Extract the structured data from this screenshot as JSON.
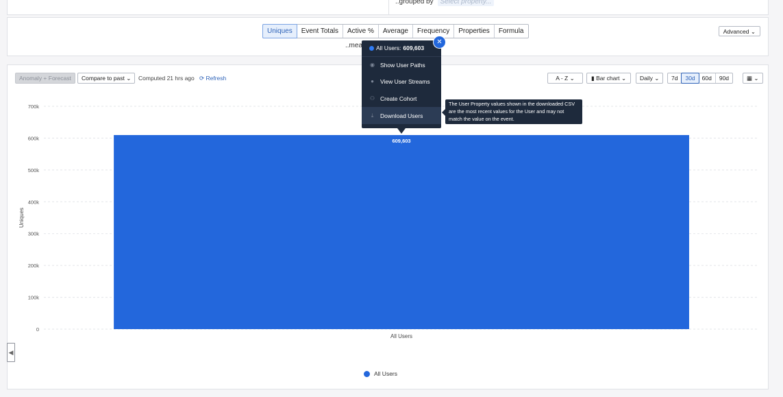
{
  "grouped_by": {
    "label": "..grouped by",
    "placeholder": "Select property..."
  },
  "measure": {
    "tabs": [
      {
        "label": "Uniques",
        "active": true
      },
      {
        "label": "Event Totals"
      },
      {
        "label": "Active %"
      },
      {
        "label": "Average"
      },
      {
        "label": "Frequency"
      },
      {
        "label": "Properties"
      },
      {
        "label": "Formula"
      }
    ],
    "label": "..mea",
    "advanced_label": "Advanced"
  },
  "toolbar": {
    "anomaly_label": "Anomaly + Forecast",
    "compare_label": "Compare to past",
    "computed_text": "Computed 21 hrs ago",
    "refresh_label": "Refresh",
    "sort_label": "A - Z",
    "chart_type_label": "Bar chart",
    "interval_label": "Daily",
    "ranges": [
      {
        "label": "7d"
      },
      {
        "label": "30d",
        "active": true
      },
      {
        "label": "60d"
      },
      {
        "label": "90d"
      }
    ]
  },
  "popup": {
    "series_name": "All Users:",
    "series_value": "609,603",
    "items": [
      {
        "label": "Show User Paths",
        "icon": "eye-icon"
      },
      {
        "label": "View User Streams",
        "icon": "user-icon"
      },
      {
        "label": "Create Cohort",
        "icon": "users-icon"
      },
      {
        "label": "Download Users",
        "icon": "download-icon",
        "highlighted": true
      }
    ]
  },
  "tooltip": {
    "text": "The User Property values shown in the downloaded CSV are the most recent values for the User and may not match the value on the event."
  },
  "legend": {
    "label": "All Users"
  },
  "colors": {
    "accent": "#2367dc",
    "popup_bg": "#1e2a3c"
  },
  "chart_data": {
    "type": "bar",
    "categories": [
      "All Users"
    ],
    "series": [
      {
        "name": "All Users",
        "values": [
          609603
        ]
      }
    ],
    "data_labels": [
      "609,603"
    ],
    "ylabel": "Uniques",
    "ylim": [
      0,
      700000
    ],
    "yticks": [
      0,
      100000,
      200000,
      300000,
      400000,
      500000,
      600000,
      700000
    ],
    "ytick_labels": [
      "0",
      "100k",
      "200k",
      "300k",
      "400k",
      "500k",
      "600k",
      "700k"
    ],
    "grid": true,
    "legend_placement": "bottom"
  }
}
